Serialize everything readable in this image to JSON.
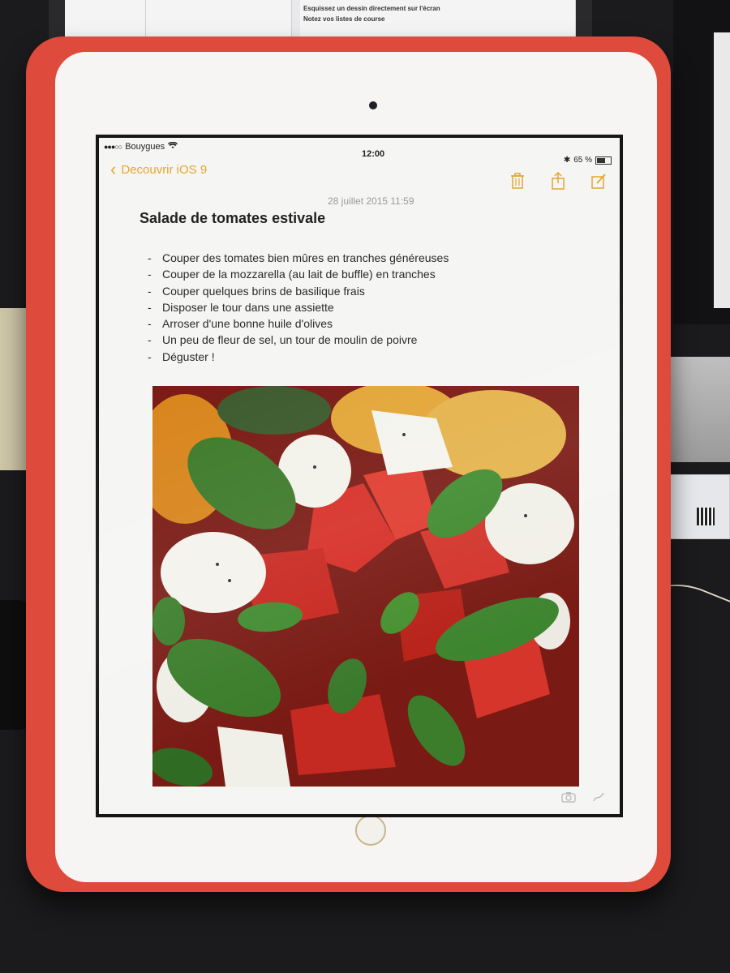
{
  "background": {
    "monitor_lines": [
      "Esquissez un dessin directement sur l'écran",
      "Notez vos listes de course"
    ]
  },
  "status_bar": {
    "carrier": "Bouygues",
    "time": "12:00",
    "battery": "65 %"
  },
  "nav": {
    "back_label": "Decouvrir iOS 9"
  },
  "toolbar": {
    "icons": [
      "trash-icon",
      "share-icon",
      "compose-icon"
    ]
  },
  "note": {
    "date": "28 juillet 2015 11:59",
    "title": "Salade de tomates estivale",
    "items": [
      "Couper des tomates bien mûres en tranches généreuses",
      "Couper de la mozzarella (au lait de buffle) en tranches",
      "Couper quelques brins de basilique frais",
      "Disposer le tour dans une assiette",
      "Arroser d'une bonne huile d'olives",
      "Un peu de fleur de sel, un tour de moulin de poivre",
      "Déguster !"
    ]
  },
  "bottom_toolbar": {
    "icons": [
      "camera-icon",
      "sketch-icon"
    ]
  },
  "colors": {
    "accent": "#e4a72c",
    "case": "#de4a3c"
  }
}
